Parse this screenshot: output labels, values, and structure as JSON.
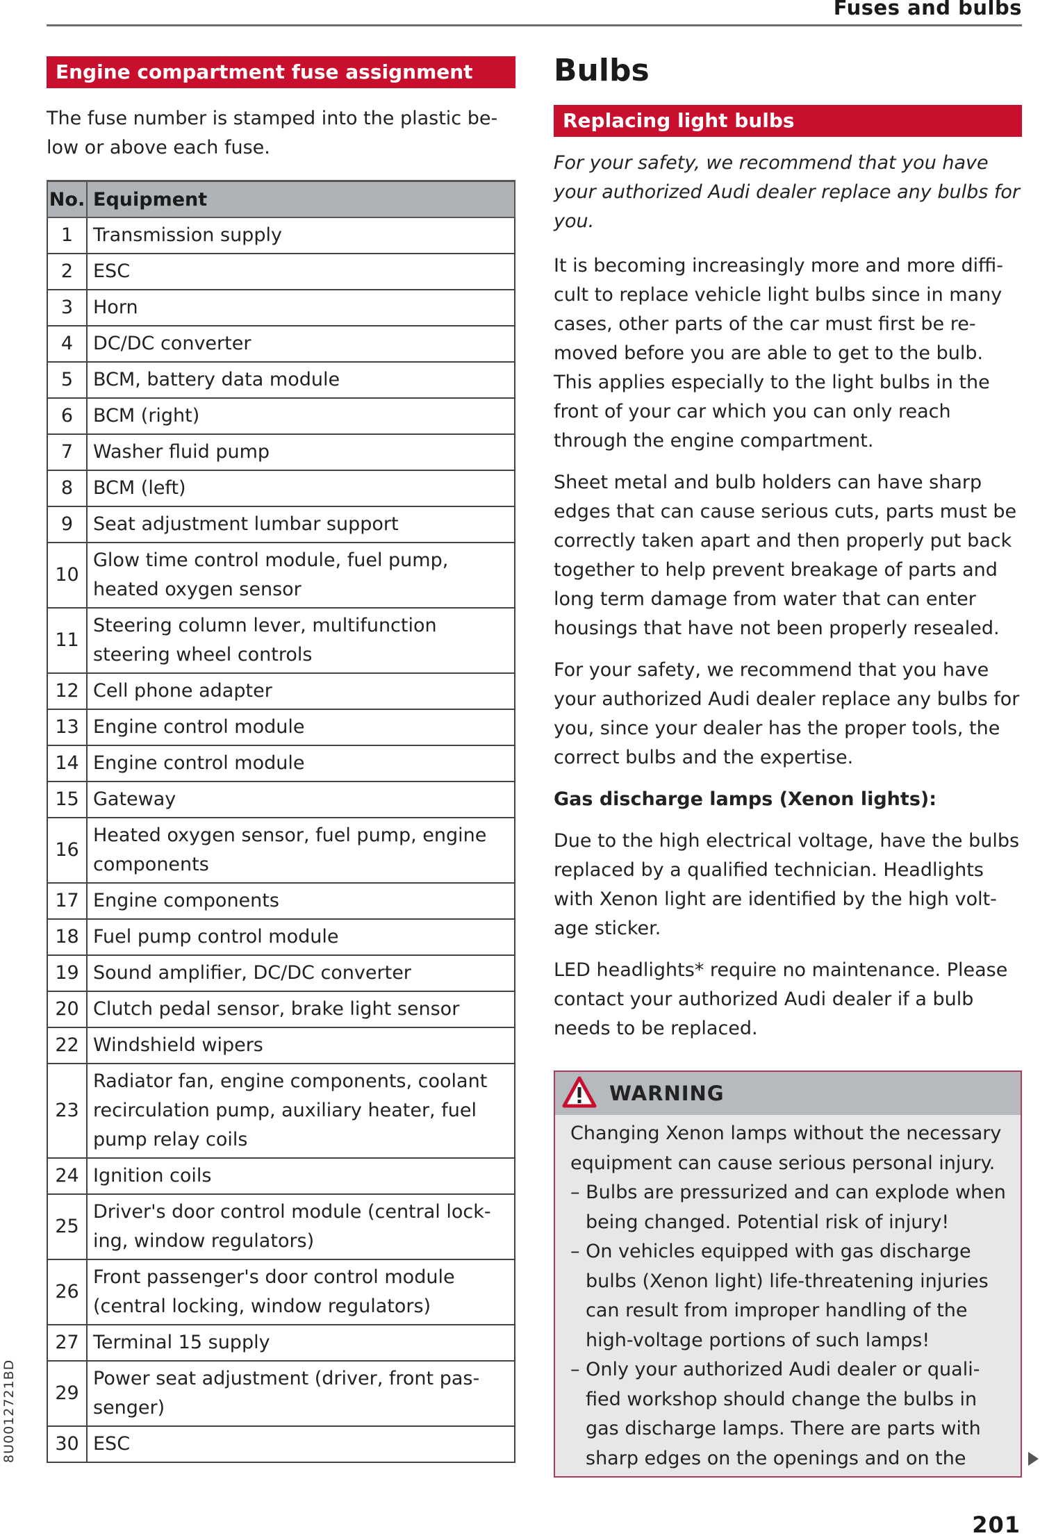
{
  "header": {
    "running_title": "Fuses and bulbs"
  },
  "left": {
    "section_title": "Engine compartment fuse assignment",
    "intro": "The fuse number is stamped into the plastic be- low or above each fuse.",
    "table": {
      "columns": [
        "No.",
        "Equipment"
      ],
      "rows": [
        {
          "no": "1",
          "equipment": "Transmission supply"
        },
        {
          "no": "2",
          "equipment": "ESC"
        },
        {
          "no": "3",
          "equipment": "Horn"
        },
        {
          "no": "4",
          "equipment": "DC/DC converter"
        },
        {
          "no": "5",
          "equipment": "BCM, battery data module"
        },
        {
          "no": "6",
          "equipment": "BCM (right)"
        },
        {
          "no": "7",
          "equipment": "Washer fluid pump"
        },
        {
          "no": "8",
          "equipment": "BCM (left)"
        },
        {
          "no": "9",
          "equipment": "Seat adjustment lumbar support"
        },
        {
          "no": "10",
          "equipment": "Glow time control module, fuel pump, heated oxygen sensor"
        },
        {
          "no": "11",
          "equipment": "Steering column lever, multifunction steering wheel controls"
        },
        {
          "no": "12",
          "equipment": "Cell phone adapter"
        },
        {
          "no": "13",
          "equipment": "Engine control module"
        },
        {
          "no": "14",
          "equipment": "Engine control module"
        },
        {
          "no": "15",
          "equipment": "Gateway"
        },
        {
          "no": "16",
          "equipment": "Heated oxygen sensor, fuel pump, engine components"
        },
        {
          "no": "17",
          "equipment": "Engine components"
        },
        {
          "no": "18",
          "equipment": "Fuel pump control module"
        },
        {
          "no": "19",
          "equipment": "Sound amplifier, DC/DC converter"
        },
        {
          "no": "20",
          "equipment": "Clutch pedal sensor, brake light sensor"
        },
        {
          "no": "22",
          "equipment": "Windshield wipers"
        },
        {
          "no": "23",
          "equipment": "Radiator fan, engine components, coolant recirculation pump, auxiliary heater, fuel pump relay coils"
        },
        {
          "no": "24",
          "equipment": "Ignition coils"
        },
        {
          "no": "25",
          "equipment": "Driver's door control module (central lock- ing, window regulators)"
        },
        {
          "no": "26",
          "equipment": "Front passenger's door control module (central locking, window regulators)"
        },
        {
          "no": "27",
          "equipment": "Terminal 15 supply"
        },
        {
          "no": "29",
          "equipment": "Power seat adjustment (driver, front pas- senger)"
        },
        {
          "no": "30",
          "equipment": "ESC"
        }
      ]
    }
  },
  "right": {
    "chapter_title": "Bulbs",
    "section_title": "Replacing light bulbs",
    "paragraphs": {
      "safety_italic": "For your safety, we recommend that you have your authorized Audi dealer replace any bulbs for you.",
      "difficulty": "It is becoming increasingly more and more diffi- cult to replace vehicle light bulbs since in many cases, other parts of the car must first be re- moved before you are able to get to the bulb. This applies especially to the light bulbs in the front of your car which you can only reach through the engine compartment.",
      "sharp_edges": "Sheet metal and bulb holders can have sharp edges that can cause serious cuts, parts must be correctly taken apart and then properly put back together to help prevent breakage of parts and long term damage from water that can enter housings that have not been properly resealed.",
      "dealer": "For your safety, we recommend that you have your authorized Audi dealer replace any bulbs for you, since your dealer has the proper tools, the correct bulbs and the expertise.",
      "xenon_heading": "Gas discharge lamps (Xenon lights):",
      "xenon_text": "Due to the high electrical voltage, have the bulbs replaced by a qualified technician. Headlights with Xenon light are identified by the high volt- age sticker.",
      "led_text": "LED headlights* require no maintenance. Please contact your authorized Audi dealer if a bulb needs to be replaced."
    },
    "warning": {
      "icon": "warning-triangle-icon",
      "title": "WARNING",
      "intro": "Changing Xenon lamps without the necessary equipment can cause serious personal injury.",
      "items": [
        "Bulbs are pressurized and can explode when being changed. Potential risk of injury!",
        "On vehicles equipped with gas discharge bulbs (Xenon light) life-threatening injuries can result from improper handling of the high-voltage portions of such lamps!",
        "Only your authorized Audi dealer or quali- fied workshop should change the bulbs in gas discharge lamps. There are parts with sharp edges on the openings and on the"
      ]
    }
  },
  "footer": {
    "page_number": "201",
    "document_code": "8U0012721BD",
    "continue_icon": "continue-arrow-icon"
  },
  "colors": {
    "section_bar": "#c8102e",
    "table_header": "#aeb3b8",
    "warning_border": "#b0395a",
    "warning_header": "#b6babe",
    "warning_body": "#e6e7e8"
  }
}
